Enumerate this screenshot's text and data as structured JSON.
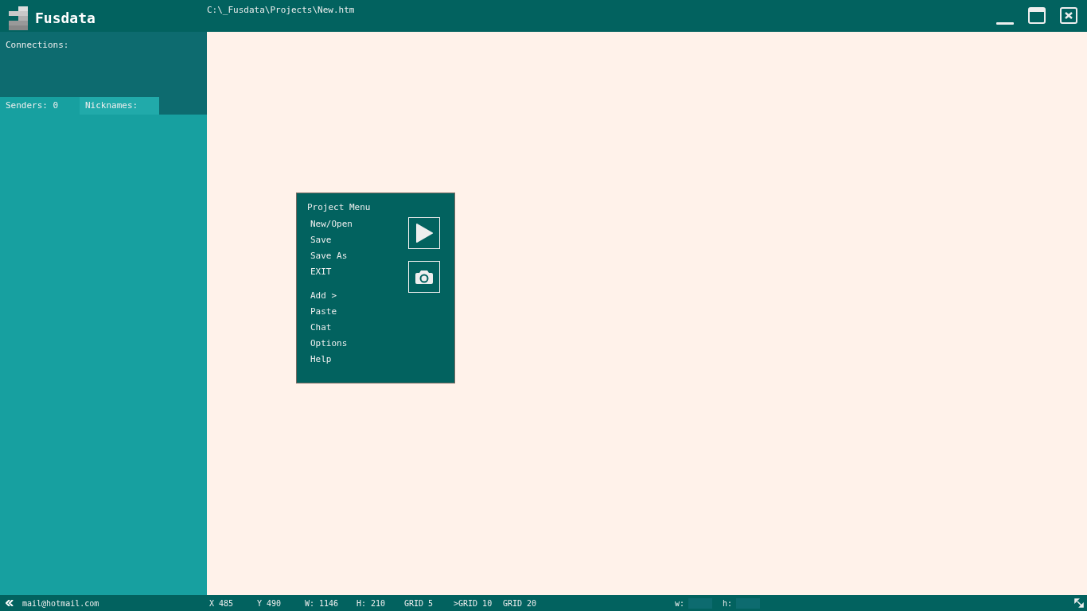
{
  "app": {
    "name": "Fusdata"
  },
  "window": {
    "title": "C:\\_Fusdata\\Projects\\New.htm"
  },
  "sidebar": {
    "connections_label": "Connections:",
    "senders": "Senders: 0",
    "nicknames": "Nicknames:"
  },
  "project_menu": {
    "title": "Project Menu",
    "groups": [
      [
        "New/Open",
        "Save",
        "Save As",
        "EXIT"
      ],
      [
        "Add >",
        "Paste",
        "Chat",
        "Options",
        "Help"
      ]
    ]
  },
  "status_bar": {
    "email": "mail@hotmail.com",
    "x": "X 485",
    "y": "Y 490",
    "w": "W: 1146",
    "h": "H: 210",
    "grids": [
      "GRID 5",
      ">GRID 10",
      "GRID 20"
    ],
    "w_label": "w:",
    "h_label": "h:"
  }
}
